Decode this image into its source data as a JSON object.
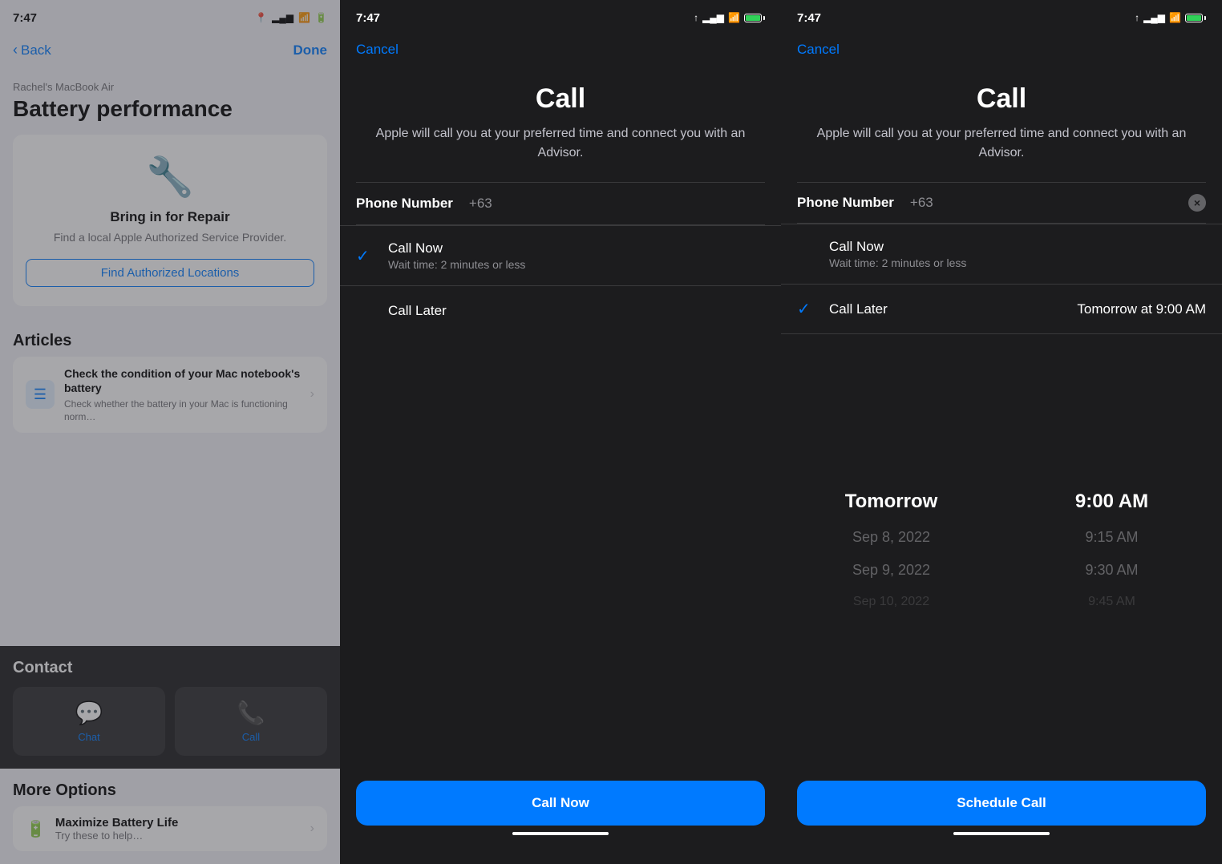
{
  "panel1": {
    "status": {
      "time": "7:47",
      "location": "📍",
      "signal": "▂▄▆",
      "wifi": "WiFi",
      "battery": "🔋"
    },
    "nav": {
      "back_label": "Back",
      "done_label": "Done"
    },
    "device_label": "Rachel's MacBook Air",
    "page_title": "Battery performance",
    "repair_card": {
      "icon": "🔧",
      "title": "Bring in for Repair",
      "description": "Find a local Apple Authorized Service Provider.",
      "button_label": "Find Authorized Locations"
    },
    "articles_section": "Articles",
    "article": {
      "title": "Check the condition of your Mac notebook's battery",
      "description": "Check whether the battery in your Mac is functioning norm…"
    },
    "contact_section": "Contact",
    "chat_label": "Chat",
    "call_label": "Call",
    "more_options_section": "More Options",
    "more_item": {
      "title": "Maximize Battery Life",
      "description": "Try these to help…"
    }
  },
  "panel2": {
    "status": {
      "time": "7:47",
      "location": "↑",
      "signal": "▂▄▆",
      "wifi": "WiFi",
      "battery": "🔋"
    },
    "cancel_label": "Cancel",
    "title": "Call",
    "description": "Apple will call you at your preferred time and connect you with an Advisor.",
    "phone_label": "Phone Number",
    "phone_value": "+63",
    "options": [
      {
        "checked": true,
        "title": "Call Now",
        "subtitle": "Wait time: 2 minutes or less"
      },
      {
        "checked": false,
        "title": "Call Later",
        "subtitle": ""
      }
    ],
    "cta_label": "Call Now"
  },
  "panel3": {
    "status": {
      "time": "7:47",
      "location": "↑",
      "signal": "▂▄▆",
      "wifi": "WiFi",
      "battery": "🔋"
    },
    "cancel_label": "Cancel",
    "title": "Call",
    "description": "Apple will call you at your preferred time and connect you with an Advisor.",
    "phone_label": "Phone Number",
    "phone_value": "+63",
    "options": [
      {
        "checked": false,
        "title": "Call Now",
        "subtitle": "Wait time: 2 minutes or less",
        "right": ""
      },
      {
        "checked": true,
        "title": "Call Later",
        "subtitle": "",
        "right": "Tomorrow at 9:00 AM"
      }
    ],
    "picker": {
      "dates": [
        "Tomorrow",
        "Sep 8, 2022",
        "Sep 9, 2022",
        "Sep 10, 2022"
      ],
      "times": [
        "9:00 AM",
        "9:15 AM",
        "9:30 AM",
        "9:45 AM"
      ]
    },
    "cta_label": "Schedule Call"
  }
}
